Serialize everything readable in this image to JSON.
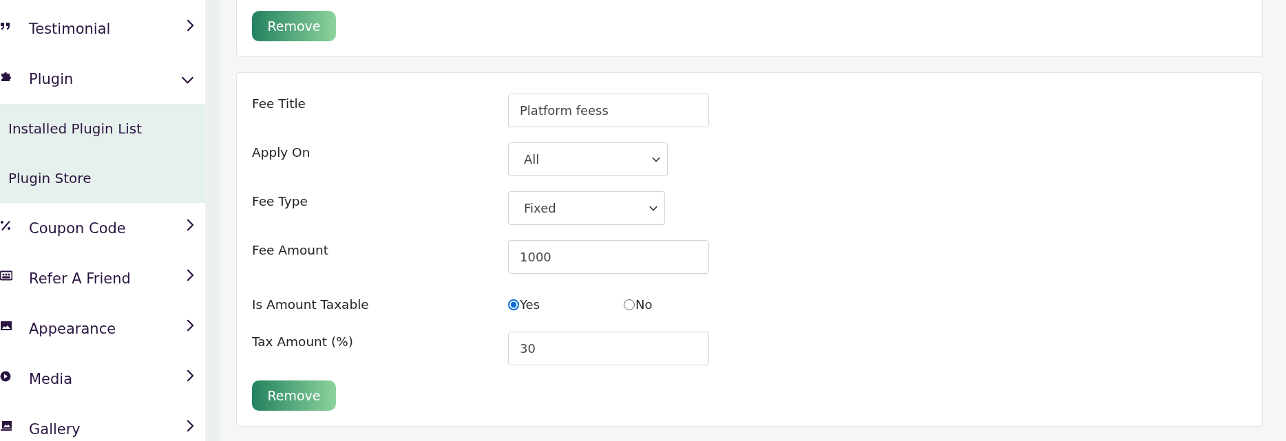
{
  "sidebar": {
    "items": [
      {
        "label": "Testimonial",
        "expanded": false
      },
      {
        "label": "Plugin",
        "expanded": true,
        "children": [
          {
            "label": "Installed Plugin List"
          },
          {
            "label": "Plugin Store"
          }
        ]
      },
      {
        "label": "Coupon Code",
        "expanded": false
      },
      {
        "label": "Refer A Friend",
        "expanded": false
      },
      {
        "label": "Appearance",
        "expanded": false
      },
      {
        "label": "Media",
        "expanded": false
      },
      {
        "label": "Gallery",
        "expanded": false
      }
    ]
  },
  "fee_cards": [
    {
      "button": "Remove"
    },
    {
      "fields": [
        {
          "kind": "text",
          "label": "Fee Title",
          "value": "Platform feess"
        },
        {
          "kind": "select",
          "label": "Apply On",
          "value": "All"
        },
        {
          "kind": "select",
          "label": "Fee Type",
          "value": "Fixed"
        },
        {
          "kind": "text",
          "label": "Fee Amount",
          "value": "1000"
        },
        {
          "kind": "radio",
          "label": "Is Amount Taxable",
          "options": [
            {
              "label": "Yes",
              "selected": true
            },
            {
              "label": "No",
              "selected": false
            }
          ]
        },
        {
          "kind": "text",
          "label": "Tax Amount (%)",
          "value": "30"
        }
      ],
      "button": "Remove"
    }
  ]
}
